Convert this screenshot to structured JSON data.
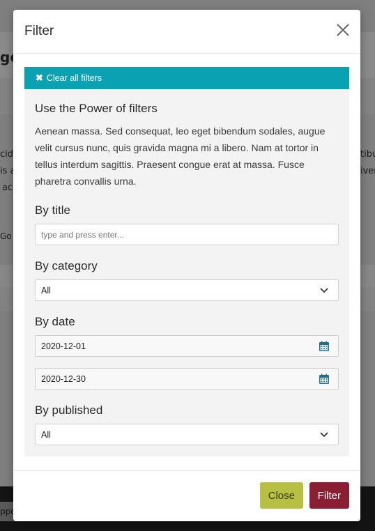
{
  "background": {
    "fragments": [
      "ge",
      "cidu",
      "is a",
      "ac",
      "Go",
      "tibu",
      "iver",
      "ppo"
    ]
  },
  "modal": {
    "title": "Filter",
    "clear_label": "Clear all filters",
    "heading": "Use the Power of filters",
    "description": "Aenean massa. Sed consequat, leo eget bibendum sodales, augue velit cursus nunc, quis gravida magna mi a libero. Nam at tortor in tellus interdum sagittis. Praesent congue erat at massa. Fusce pharetra convallis urna.",
    "by_title": {
      "label": "By title",
      "placeholder": "type and press enter..."
    },
    "by_category": {
      "label": "By category",
      "value": "All"
    },
    "by_date": {
      "label": "By date",
      "from": "2020-12-01",
      "to": "2020-12-30"
    },
    "by_published": {
      "label": "By published",
      "value": "All"
    },
    "buttons": {
      "close": "Close",
      "filter": "Filter"
    }
  },
  "colors": {
    "clear_bar": "#0aa1b3",
    "close_button": "#b8c043",
    "filter_button": "#8a1e32"
  }
}
